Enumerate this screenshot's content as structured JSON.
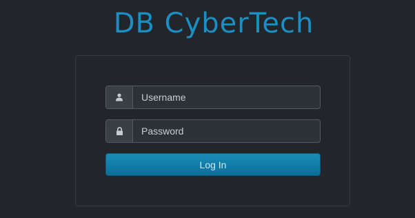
{
  "brand": {
    "logo_text": "DB CyberTech",
    "color": "#1b8fc4"
  },
  "login_form": {
    "username": {
      "placeholder": "Username",
      "value": "",
      "icon": "user-icon"
    },
    "password": {
      "placeholder": "Password",
      "value": "",
      "icon": "lock-icon"
    },
    "submit_label": "Log In"
  },
  "colors": {
    "background": "#22252a",
    "button": "#0b7aa8",
    "field": "#2d3238"
  }
}
